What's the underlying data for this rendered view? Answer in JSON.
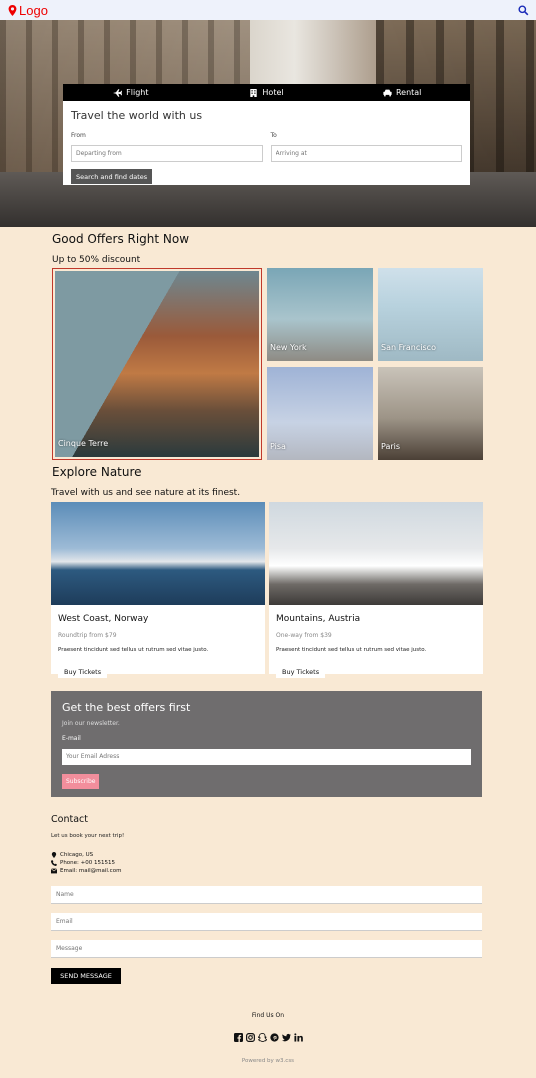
{
  "header": {
    "logo_text": "Logo",
    "logo_color": "#ee0000"
  },
  "hero": {
    "tabs": [
      {
        "label": "Flight",
        "icon": "plane-icon"
      },
      {
        "label": "Hotel",
        "icon": "building-icon"
      },
      {
        "label": "Rental",
        "icon": "car-icon"
      }
    ],
    "title": "Travel the world with us",
    "from_label": "From",
    "from_placeholder": "Departing from",
    "to_label": "To",
    "to_placeholder": "Arriving at",
    "search_button": "Search and find dates"
  },
  "offers": {
    "title": "Good Offers Right Now",
    "subtitle": "Up to 50% discount",
    "items": [
      {
        "label": "Cinque Terre"
      },
      {
        "label": "New York"
      },
      {
        "label": "San Francisco"
      },
      {
        "label": "Pisa"
      },
      {
        "label": "Paris"
      }
    ]
  },
  "nature": {
    "title": "Explore Nature",
    "subtitle": "Travel with us and see nature at its finest.",
    "cards": [
      {
        "title": "West Coast, Norway",
        "price": "Roundtrip from $79",
        "desc": "Praesent tincidunt sed tellus ut rutrum sed vitae justo.",
        "button": "Buy Tickets"
      },
      {
        "title": "Mountains, Austria",
        "price": "One-way from $39",
        "desc": "Praesent tincidunt sed tellus ut rutrum sed vitae justo.",
        "button": "Buy Tickets"
      }
    ]
  },
  "newsletter": {
    "title": "Get the best offers first",
    "subtitle": "Join our newsletter.",
    "label": "E-mail",
    "placeholder": "Your Email Adress",
    "button": "Subscribe",
    "button_color": "#f28e9c"
  },
  "contact": {
    "title": "Contact",
    "subtitle": "Let us book your next trip!",
    "location": "Chicago, US",
    "phone": "Phone: +00 151515",
    "email": "Email: mail@mail.com",
    "name_placeholder": "Name",
    "email_placeholder": "Email",
    "message_placeholder": "Message",
    "send_button": "SEND MESSAGE"
  },
  "footer": {
    "find_us": "Find Us On",
    "social_icons": [
      "facebook-icon",
      "instagram-icon",
      "snapchat-icon",
      "pinterest-icon",
      "twitter-icon",
      "linkedin-icon"
    ],
    "powered_by": "Powered by w3.css"
  }
}
